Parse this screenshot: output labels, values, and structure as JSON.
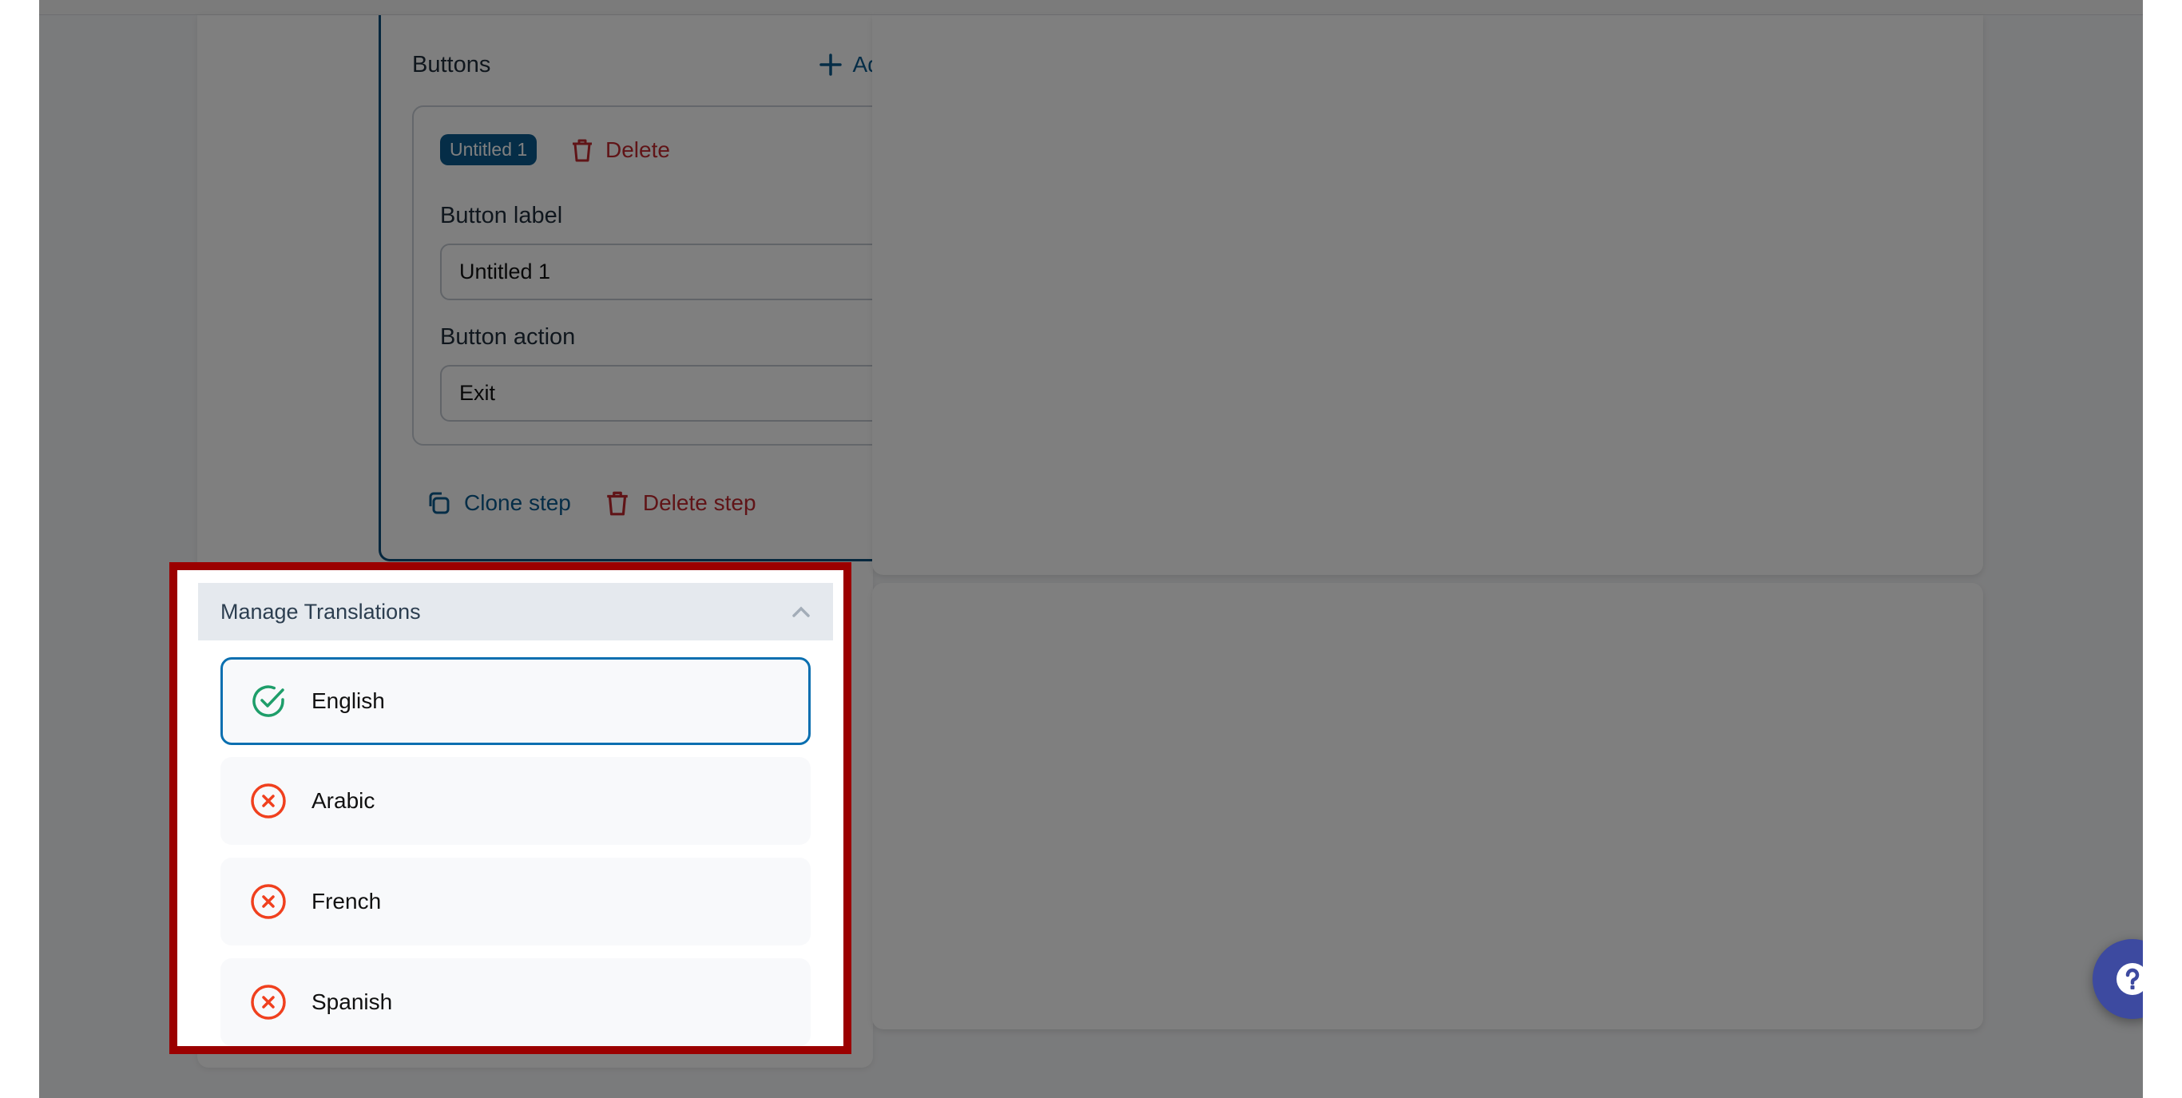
{
  "editor": {
    "buttons_section": {
      "title": "Buttons",
      "add_button_label": "Add button",
      "button_item": {
        "badge": "Untitled 1",
        "delete_label": "Delete",
        "label_field": {
          "label": "Button label",
          "value": "Untitled 1"
        },
        "action_field": {
          "label": "Button action",
          "value": "Exit"
        }
      }
    },
    "step_actions": {
      "clone_label": "Clone step",
      "delete_label": "Delete step"
    }
  },
  "translations": {
    "title": "Manage Translations",
    "languages": [
      {
        "name": "English",
        "status": "complete",
        "selected": true
      },
      {
        "name": "Arabic",
        "status": "missing",
        "selected": false
      },
      {
        "name": "French",
        "status": "missing",
        "selected": false
      },
      {
        "name": "Spanish",
        "status": "missing",
        "selected": false
      }
    ]
  },
  "help": {
    "icon": "question-icon"
  },
  "colors": {
    "primary": "#0b5a8e",
    "danger": "#c0282e",
    "success": "#1e9e6a",
    "error": "#f0401e",
    "highlight": "#9b0000",
    "help_button": "#3d4aa0"
  }
}
